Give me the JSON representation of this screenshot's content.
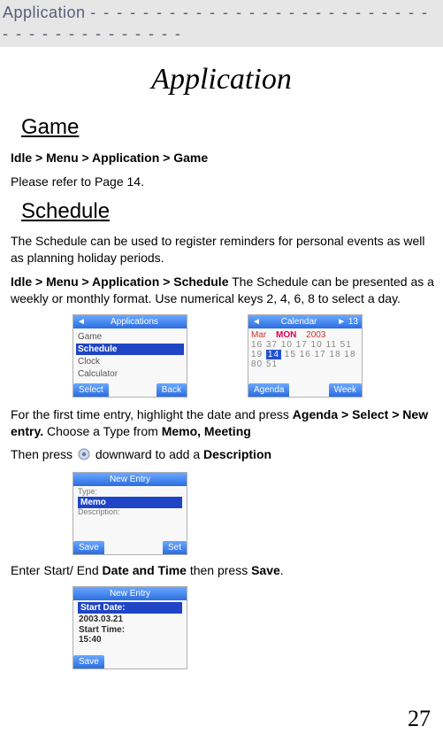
{
  "header": {
    "tab": "Application",
    "dashes": "- - - - - - - - - - - - - - - - - - - - - - - - - - - - - - - - - - - - - - - -"
  },
  "title": "Application",
  "sections": {
    "game": {
      "heading": "Game",
      "breadcrumb": "Idle > Menu > Application > Game",
      "body": "Please refer to Page 14."
    },
    "schedule": {
      "heading": "Schedule",
      "intro": "The Schedule can be used to register reminders for personal events as well as planning holiday periods.",
      "breadcrumb": "Idle > Menu > Application > Schedule",
      "after_breadcrumb": " The Schedule can be presented as a weekly or monthly format. Use numerical keys 2, 4, 6, 8 to select a day.",
      "first_entry_1": "For the first time entry, highlight the date and press ",
      "first_entry_bold1": "Agenda > Select > New entry.",
      "first_entry_2": " Choose a Type from ",
      "first_entry_bold2": "Memo, Meeting",
      "then_press_1": "Then press ",
      "then_press_2": "downward to add a ",
      "then_press_bold": "Description",
      "start_end_1": "Enter Start/ End ",
      "start_end_bold1": "Date and Time",
      "start_end_2": " then press ",
      "start_end_bold2": "Save",
      "start_end_3": "."
    }
  },
  "screenshots": {
    "app_list": {
      "header_left": "◄",
      "header_title": "Applications",
      "items": [
        "Game",
        "Schedule",
        "Clock",
        "Calculator"
      ],
      "selected_index": 1,
      "softkeys": {
        "left": "Select",
        "right": "Back"
      }
    },
    "calendar": {
      "header_left": "◄",
      "header_title": "Calendar",
      "header_right": "► 13",
      "month_row": {
        "left": "Mar",
        "center": "MON",
        "right": "2003"
      },
      "weeks": [
        "16 37 10 17 10 11 51",
        "19 14 15 16 17 18 18",
        "80 51"
      ],
      "today_cell": "14",
      "softkeys": {
        "left": "Agenda",
        "right": "Week"
      }
    },
    "new_entry_1": {
      "header_title": "New Entry",
      "fields": {
        "type": "Type:",
        "selected": "Memo",
        "desc": "Description:"
      },
      "softkeys": {
        "left": "Save",
        "right": "Set"
      }
    },
    "new_entry_2": {
      "header_title": "New Entry",
      "fields": {
        "label1": "Start Date:",
        "val1": "2003.03.21",
        "label2": "Start Time:",
        "val2": "15:40"
      },
      "softkeys": {
        "left": "Save",
        "right": ""
      }
    }
  },
  "page_number": "27"
}
